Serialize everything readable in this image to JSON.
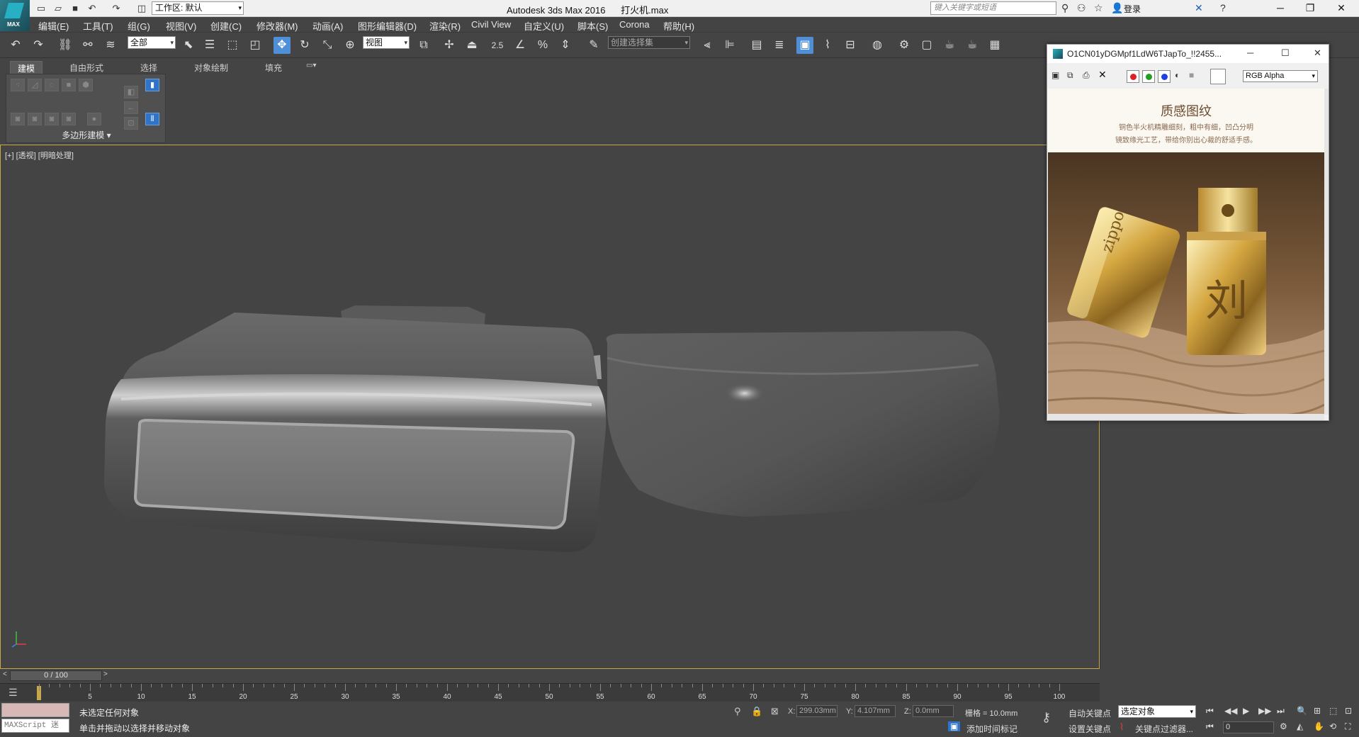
{
  "titlebar": {
    "workspace_label": "工作区: 默认",
    "window_title": "Autodesk 3ds Max 2016      打火机.max",
    "search_placeholder": "键入关键字或短语",
    "login_label": "登录",
    "logo_text": "MAX"
  },
  "menu": [
    "编辑(E)",
    "工具(T)",
    "组(G)",
    "视图(V)",
    "创建(C)",
    "修改器(M)",
    "动画(A)",
    "图形编辑器(D)",
    "渲染(R)",
    "Civil View",
    "自定义(U)",
    "脚本(S)",
    "Corona",
    "帮助(H)"
  ],
  "toolbar": {
    "selection_filter": "全部",
    "ref_coord": "视图",
    "named_selection": "创建选择集",
    "snap_label": "2.5",
    "angle_snap_label": "∠",
    "percent_snap_label": "%"
  },
  "ribbon": {
    "tabs": [
      "建模",
      "自由形式",
      "选择",
      "对象绘制",
      "填充"
    ],
    "group_label": "多边形建模"
  },
  "viewport": {
    "label": "[+] [透视] [明暗处理]"
  },
  "frame_buffer": {
    "title": "O1CN01yDGMpf1LdW6TJapTo_!!2455...",
    "channel": "RGB Alpha",
    "headline": "质感图纹",
    "line1": "铜色半火机精雕细刻，粗中有细，凹凸分明",
    "line2": "镜致缘光工艺，带给你别出心裁的舒适手感。",
    "engraving": "刘",
    "brand": "zippo",
    "colors": {
      "red": "#e02020",
      "green": "#20a020",
      "blue": "#2040e0"
    }
  },
  "timeline": {
    "frame_display": "0 / 100",
    "ticks": [
      "5",
      "10",
      "15",
      "20",
      "25",
      "30",
      "35",
      "40",
      "45",
      "50",
      "55",
      "60",
      "65",
      "70",
      "75",
      "80",
      "85",
      "90",
      "95",
      "100"
    ],
    "left_arrow": "<",
    "right_arrow": ">"
  },
  "status": {
    "maxscript_label": "MAXScript 迷",
    "message1": "未选定任何对象",
    "message2": "单击并拖动以选择并移动对象",
    "x_label": "X:",
    "x_value": "299.03mm",
    "y_label": "Y:",
    "y_value": "4.107mm",
    "z_label": "Z:",
    "z_value": "0.0mm",
    "grid": "栅格 = 10.0mm",
    "add_time_tag": "添加时间标记",
    "auto_key": "自动关键点",
    "set_key": "设置关键点",
    "key_selection": "选定对象",
    "key_filters": "关键点过滤器...",
    "current_frame": "0"
  }
}
